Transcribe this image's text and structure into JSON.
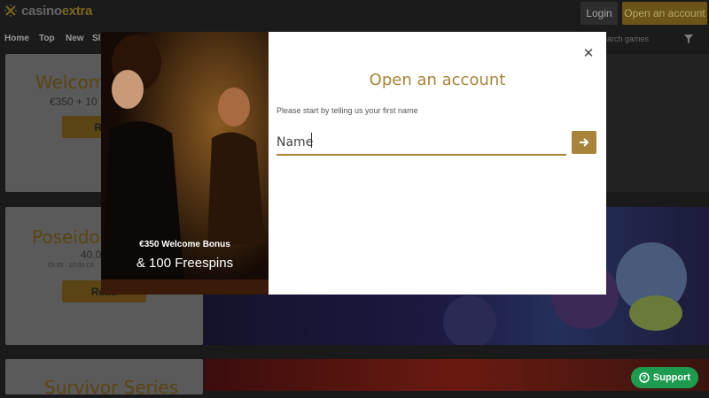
{
  "header": {
    "logo_brand": "casino",
    "logo_accent": "extra",
    "login_label": "Login",
    "open_account_label": "Open an account"
  },
  "nav": {
    "items": [
      "Home",
      "Top",
      "New",
      "Sl"
    ],
    "search_placeholder": "earch games"
  },
  "cards": [
    {
      "title": "Welcom",
      "subtitle": "€350 + 10",
      "button": "Rea"
    },
    {
      "title": "Poseido",
      "subtitle": "40.0",
      "small": "03.05 · 10:00 CE",
      "button": "Read"
    },
    {
      "title": "Survivor Series"
    }
  ],
  "modal": {
    "title": "Open an account",
    "subtitle": "Please start by telling us your first name",
    "name_placeholder": "Name",
    "image_caption_1": "€350 Welcome Bonus",
    "image_caption_2": "& 100 Freespins"
  },
  "support": {
    "label": "Support"
  },
  "colors": {
    "gold": "#a8833a",
    "support_green": "#1e9b4e"
  }
}
